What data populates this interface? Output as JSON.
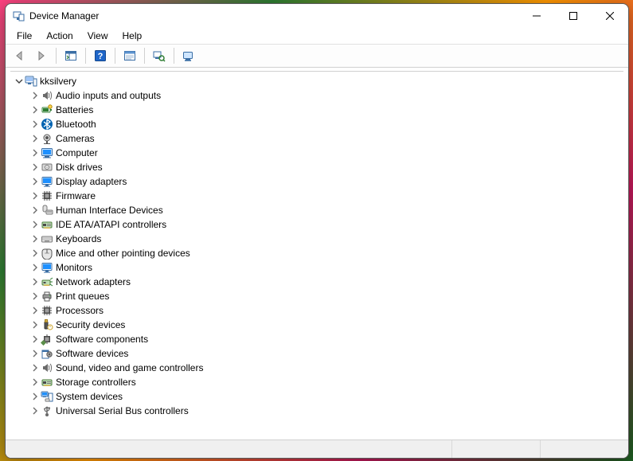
{
  "window": {
    "title": "Device Manager"
  },
  "menu": {
    "file": "File",
    "action": "Action",
    "view": "View",
    "help": "Help"
  },
  "tree": {
    "root": {
      "label": "kksilvery",
      "icon": "computer-icon",
      "expanded": true
    },
    "items": [
      {
        "label": "Audio inputs and outputs",
        "icon": "speaker-icon"
      },
      {
        "label": "Batteries",
        "icon": "battery-icon"
      },
      {
        "label": "Bluetooth",
        "icon": "bluetooth-icon"
      },
      {
        "label": "Cameras",
        "icon": "camera-icon"
      },
      {
        "label": "Computer",
        "icon": "computer-icon"
      },
      {
        "label": "Disk drives",
        "icon": "disk-drive-icon"
      },
      {
        "label": "Display adapters",
        "icon": "display-adapter-icon"
      },
      {
        "label": "Firmware",
        "icon": "firmware-icon"
      },
      {
        "label": "Human Interface Devices",
        "icon": "hid-icon"
      },
      {
        "label": "IDE ATA/ATAPI controllers",
        "icon": "ide-controller-icon"
      },
      {
        "label": "Keyboards",
        "icon": "keyboard-icon"
      },
      {
        "label": "Mice and other pointing devices",
        "icon": "mouse-icon"
      },
      {
        "label": "Monitors",
        "icon": "monitor-icon"
      },
      {
        "label": "Network adapters",
        "icon": "network-adapter-icon"
      },
      {
        "label": "Print queues",
        "icon": "printer-icon"
      },
      {
        "label": "Processors",
        "icon": "processor-icon"
      },
      {
        "label": "Security devices",
        "icon": "security-device-icon"
      },
      {
        "label": "Software components",
        "icon": "software-component-icon"
      },
      {
        "label": "Software devices",
        "icon": "software-device-icon"
      },
      {
        "label": "Sound, video and game controllers",
        "icon": "sound-controller-icon"
      },
      {
        "label": "Storage controllers",
        "icon": "storage-controller-icon"
      },
      {
        "label": "System devices",
        "icon": "system-device-icon"
      },
      {
        "label": "Universal Serial Bus controllers",
        "icon": "usb-icon"
      }
    ]
  },
  "colors": {
    "bluetooth_blue": "#0063b1",
    "monitor_blue": "#1e90ff",
    "battery_green": "#2e7d32",
    "dark_gray": "#4b4b4b"
  }
}
